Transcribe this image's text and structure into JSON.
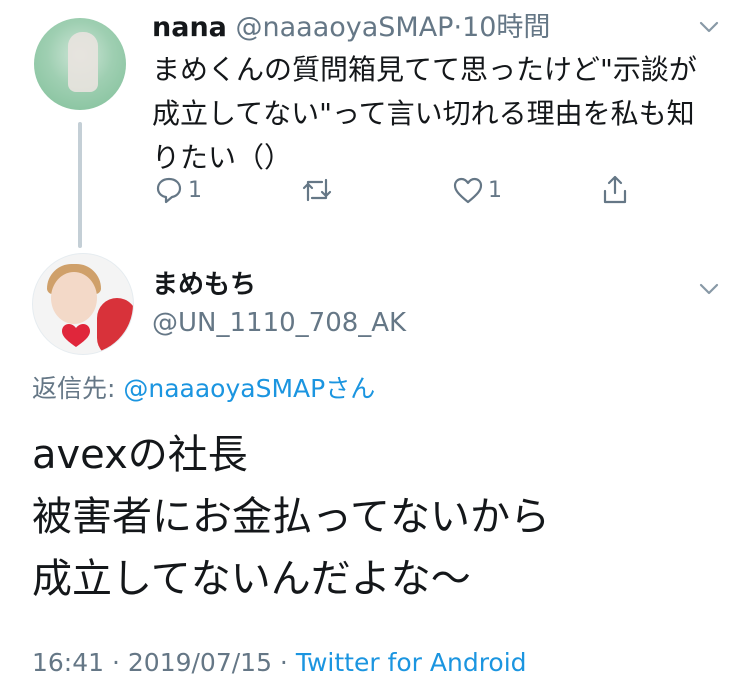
{
  "parent_tweet": {
    "display_name": "nana",
    "handle": "@naaaoyaSMAP",
    "separator": "·",
    "time": "10時間",
    "text_lines": [
      "まめくんの質問箱見てて思ったけど\"示談が",
      "成立してない\"って言い切れる理由を私も知",
      "りたい（）"
    ],
    "actions": {
      "reply_count": "1",
      "retweet_count": "",
      "like_count": "1"
    },
    "icons": [
      "reply-icon",
      "retweet-icon",
      "like-icon",
      "share-icon",
      "chevron-down-icon"
    ]
  },
  "reply_tweet": {
    "display_name": "まめもち",
    "handle": "@UN_1110_708_AK",
    "replying_prefix": "返信先: ",
    "replying_to": "@naaaoyaSMAPさん",
    "text_lines": [
      "avexの社長",
      "被害者にお金払ってないから",
      "成立してないんだよな〜"
    ],
    "time": "16:41",
    "date": "2019/07/15",
    "separator": " · ",
    "source": "Twitter for Android"
  },
  "colors": {
    "text": "#14171a",
    "secondary": "#657786",
    "link": "#1b95e0",
    "thread_line": "#c4cfd6"
  }
}
